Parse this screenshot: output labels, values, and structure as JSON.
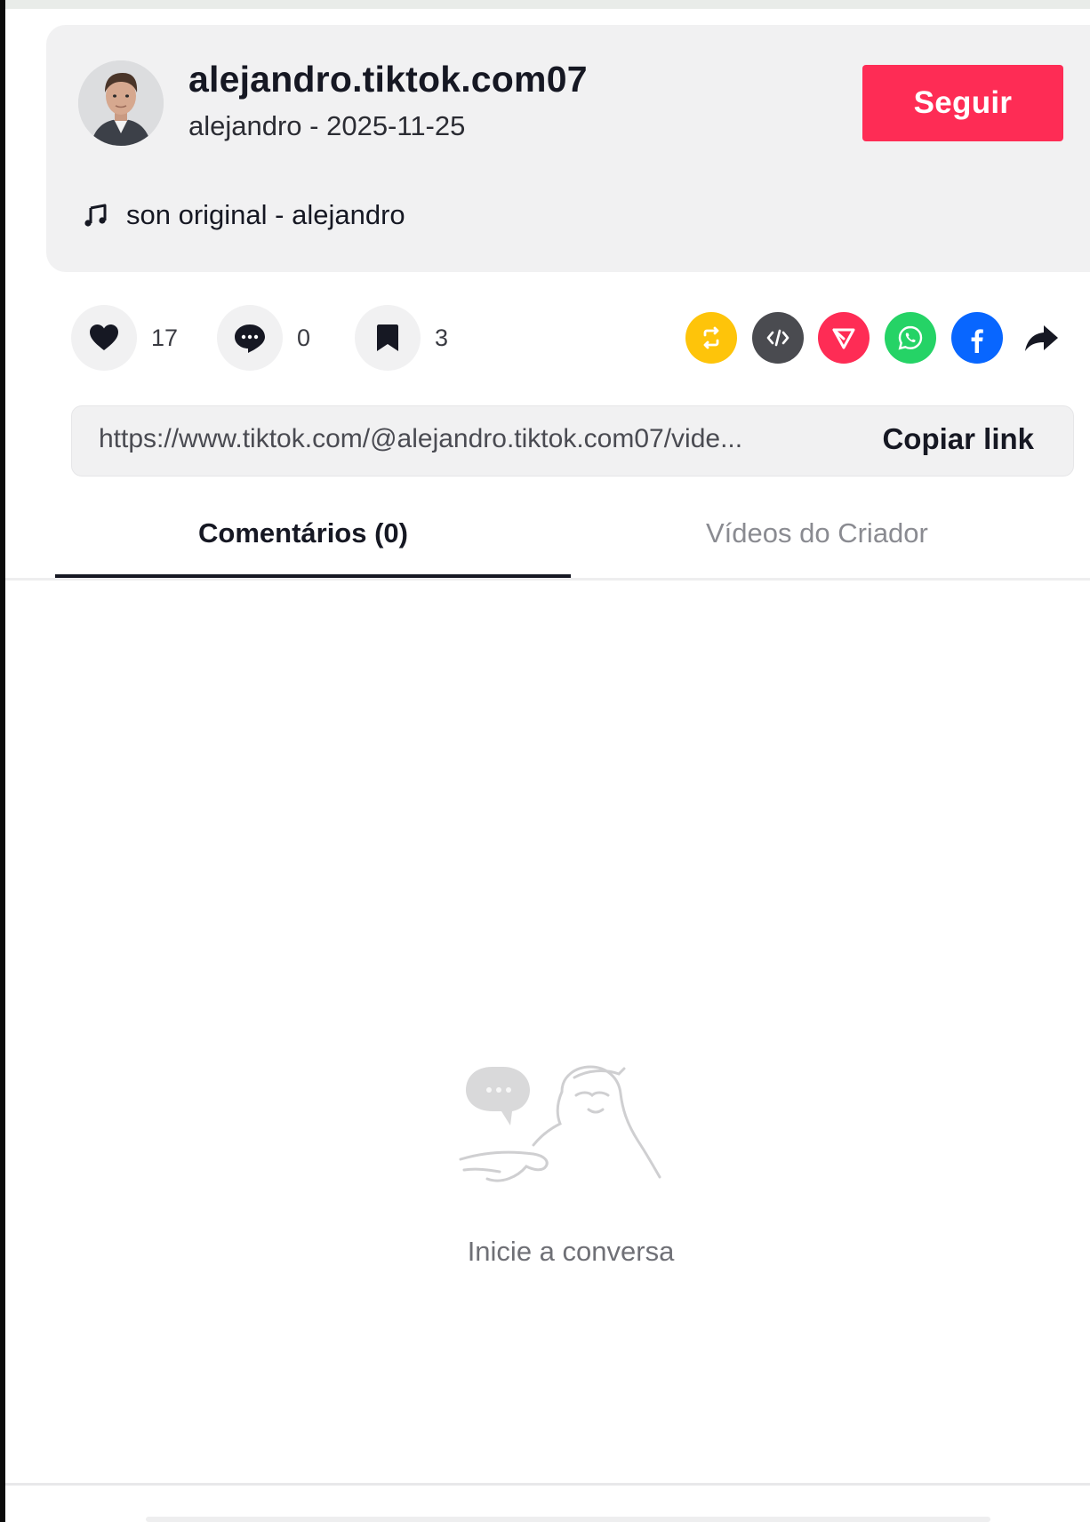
{
  "author": {
    "username": "alejandro.tiktok.com07",
    "subline": "alejandro - 2025-11-25",
    "follow_label": "Seguir"
  },
  "music": {
    "icon": "music-note-icon",
    "title": "son original - alejandro"
  },
  "stats": {
    "likes": "17",
    "comments": "0",
    "saves": "3"
  },
  "share_icons": [
    {
      "name": "repost-icon",
      "color": "#fec40a"
    },
    {
      "name": "embed-icon",
      "color": "#4a4b50"
    },
    {
      "name": "send-to-friends-icon",
      "color": "#fe2c55"
    },
    {
      "name": "whatsapp-icon",
      "color": "#25d366"
    },
    {
      "name": "facebook-icon",
      "color": "#0866ff"
    },
    {
      "name": "share-more-icon",
      "color": "#161823"
    }
  ],
  "link": {
    "url": "https://www.tiktok.com/@alejandro.tiktok.com07/vide...",
    "copy_label": "Copiar link"
  },
  "tabs": {
    "comments": "Comentários (0)",
    "creator_videos": "Vídeos do Criador"
  },
  "empty_state": {
    "text": "Inicie a conversa"
  },
  "colors": {
    "accent": "#fe2c55",
    "card_bg": "#f1f1f2"
  }
}
